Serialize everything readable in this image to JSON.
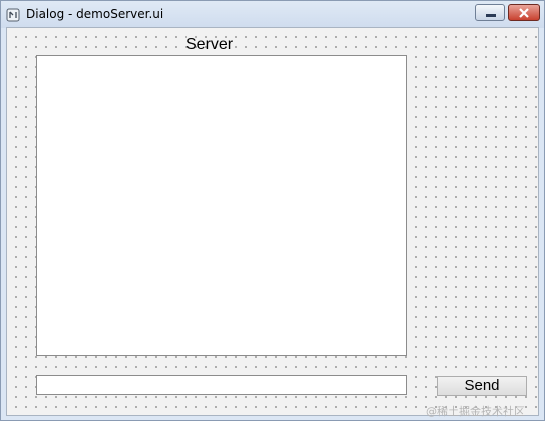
{
  "window": {
    "title": "Dialog - demoServer.ui"
  },
  "form": {
    "server_label": "Server",
    "server_list_items": [],
    "message_input_value": "",
    "send_button_label": "Send"
  },
  "watermark": "@稀土掘金技术社区",
  "colors": {
    "title_bar": "#dbe6f4",
    "close_button": "#c8412f",
    "form_background": "#f2f2f2",
    "grid_dot": "#9a9a9a"
  },
  "icons": {
    "app": "qt-designer-icon",
    "minimize": "minimize-icon",
    "close": "close-icon"
  }
}
